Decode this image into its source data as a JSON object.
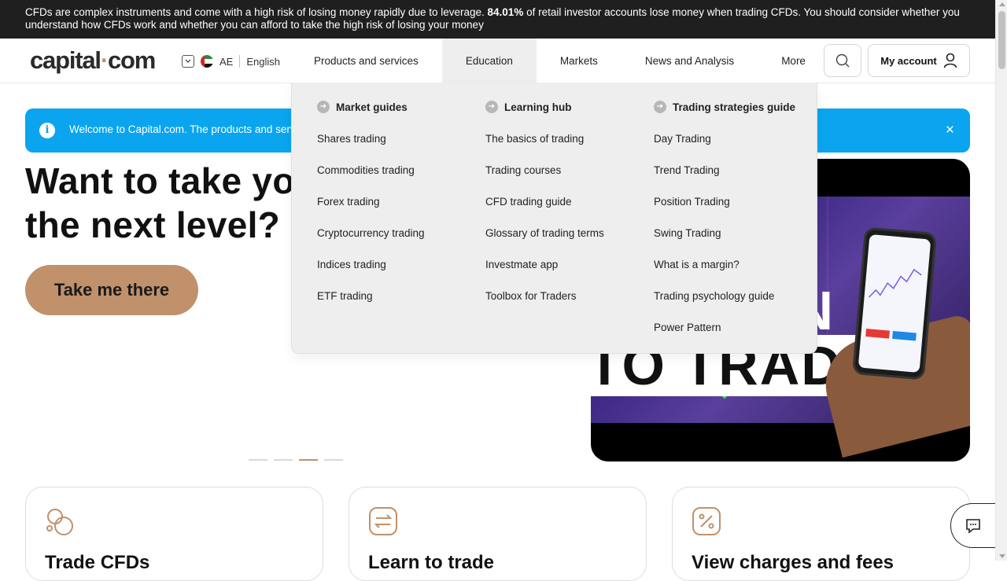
{
  "risk_warning": {
    "text_before": "CFDs are complex instruments and come with a high risk of losing money rapidly due to leverage. ",
    "percent": "84.01%",
    "text_after": " of retail investor accounts lose money when trading CFDs. You should consider whether you understand how CFDs work and whether you can afford to take the high risk of losing your money"
  },
  "header": {
    "logo_left": "capital",
    "logo_dot": "·",
    "logo_right": "com",
    "region": "AE",
    "language": "English",
    "nav": [
      {
        "label": "Products and services"
      },
      {
        "label": "Education"
      },
      {
        "label": "Markets"
      },
      {
        "label": "News and Analysis"
      },
      {
        "label": "More"
      }
    ],
    "active_nav": "Education",
    "account_label": "My account"
  },
  "banner": {
    "text": "Welcome to Capital.com. The products and serv",
    "close_icon": "×",
    "info_icon": "i"
  },
  "hero": {
    "title_line1": "Want to take yo",
    "title_line2": "the next level?",
    "cta_label": "Take me there",
    "image_text_line1": "N",
    "image_text_line2": "TO TRADING",
    "slides_total": 4,
    "slide_active": 3
  },
  "education_menu": {
    "columns": [
      {
        "heading": "Market guides",
        "links": [
          "Shares trading",
          "Commodities trading",
          "Forex trading",
          "Cryptocurrency trading",
          "Indices trading",
          "ETF trading"
        ]
      },
      {
        "heading": "Learning hub",
        "links": [
          "The basics of trading",
          "Trading courses",
          "CFD trading guide",
          "Glossary of trading terms",
          "Investmate app",
          "Toolbox for Traders"
        ]
      },
      {
        "heading": "Trading strategies guide",
        "links": [
          "Day Trading",
          "Trend Trading",
          "Position Trading",
          "Swing Trading",
          "What is a margin?",
          "Trading psychology guide",
          "Power Pattern"
        ]
      }
    ]
  },
  "cards": [
    {
      "title": "Trade CFDs",
      "icon": "coins-icon"
    },
    {
      "title": "Learn to trade",
      "icon": "exchange-icon"
    },
    {
      "title": "View charges and fees",
      "icon": "percent-icon"
    }
  ],
  "colors": {
    "accent": "#c0916a",
    "banner": "#0aa5ee",
    "topbar": "#1f1f1f"
  }
}
